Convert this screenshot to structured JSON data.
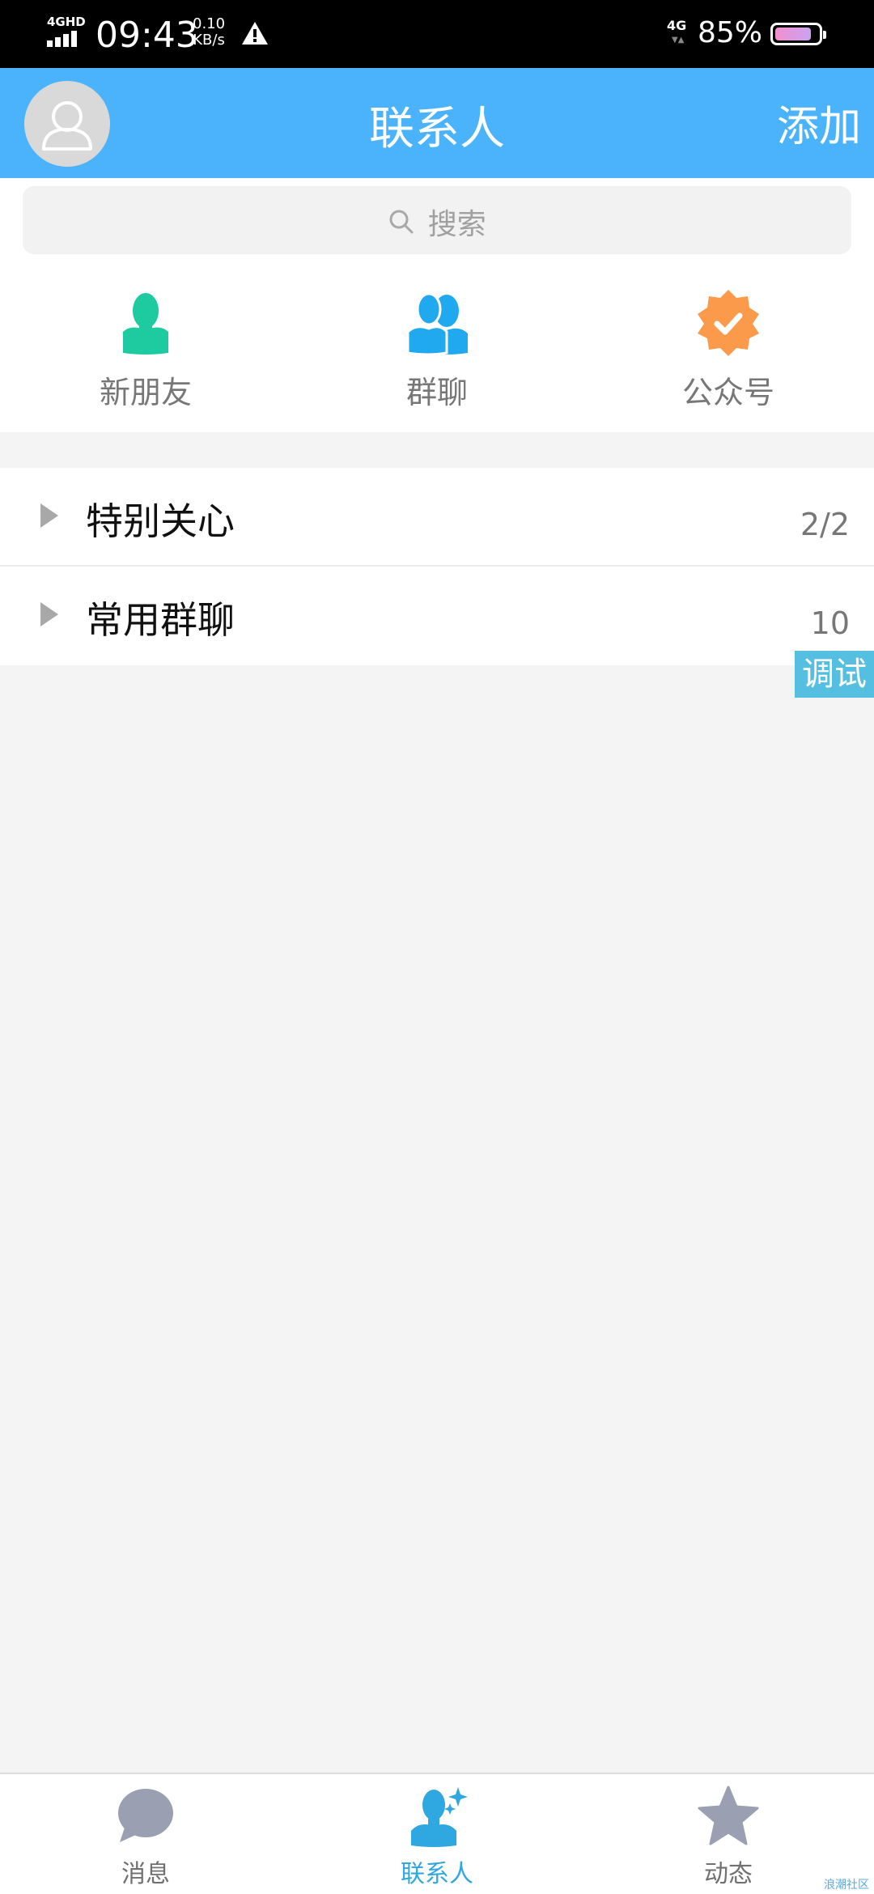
{
  "status_bar": {
    "network": "4GHD",
    "time": "09:43",
    "speed_value": "0.10",
    "speed_unit": "KB/s",
    "mobile": "4G",
    "battery": "85%",
    "battery_level": 0.85
  },
  "header": {
    "title": "联系人",
    "add_label": "添加"
  },
  "search": {
    "placeholder": "搜索"
  },
  "shortcuts": [
    {
      "label": "新朋友",
      "icon": "person-icon",
      "color": "#1ecba1"
    },
    {
      "label": "群聊",
      "icon": "group-icon",
      "color": "#21a9f0"
    },
    {
      "label": "公众号",
      "icon": "verified-badge-icon",
      "color": "#fb9a4a"
    }
  ],
  "groups": [
    {
      "name": "特别关心",
      "count": "2/2"
    },
    {
      "name": "常用群聊",
      "count": "10"
    }
  ],
  "debug_label": "调试",
  "tabs": [
    {
      "label": "消息",
      "icon": "message-bubble-icon",
      "active": false
    },
    {
      "label": "联系人",
      "icon": "contacts-icon",
      "active": true
    },
    {
      "label": "动态",
      "icon": "star-icon",
      "active": false
    }
  ],
  "watermark": "浪潮社区",
  "colors": {
    "header": "#4ab3fb",
    "active_tab": "#2fa7e0",
    "inactive_icon": "#9aa0b2"
  }
}
